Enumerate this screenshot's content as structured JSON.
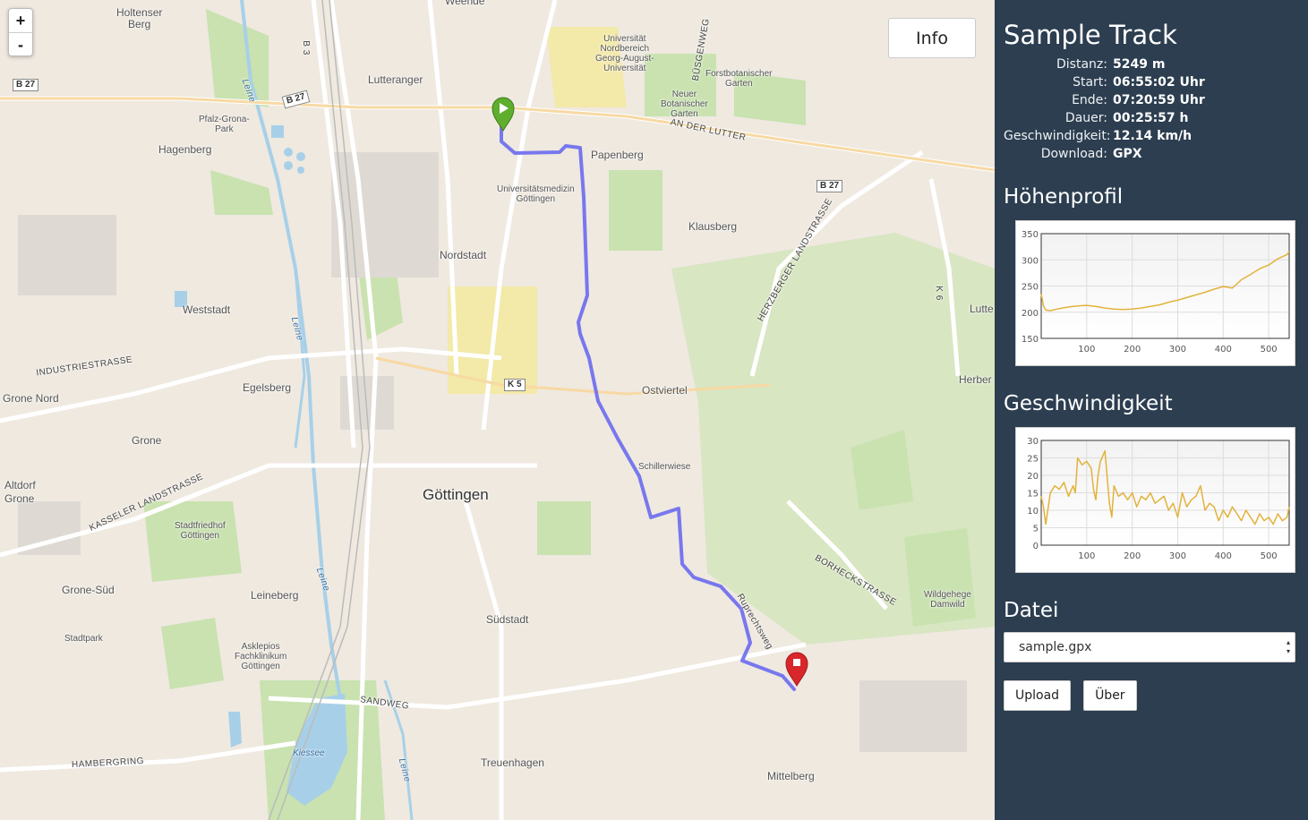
{
  "map": {
    "zoom_in": "+",
    "zoom_out": "-",
    "info_button": "Info",
    "places": [
      {
        "id": "weende",
        "text": "Weende"
      },
      {
        "id": "holtensen",
        "text": "Holtenser\nBerg"
      },
      {
        "id": "lutteranger",
        "text": "Lutteranger"
      },
      {
        "id": "pfalz",
        "text": "Pfalz-Grona-\nPark"
      },
      {
        "id": "hagenberg",
        "text": "Hagenberg"
      },
      {
        "id": "uni-nord",
        "text": "Universität\nNordbereich\nGeorg-August-\nUniversität"
      },
      {
        "id": "forstbot",
        "text": "Forstbotanischer\nGarten"
      },
      {
        "id": "neuer-bot",
        "text": "Neuer\nBotanischer\nGarten"
      },
      {
        "id": "papenberg",
        "text": "Papenberg"
      },
      {
        "id": "unimed",
        "text": "Universitätsmedizin\nGöttingen"
      },
      {
        "id": "klausberg",
        "text": "Klausberg"
      },
      {
        "id": "nordstadt",
        "text": "Nordstadt"
      },
      {
        "id": "weststadt",
        "text": "Weststadt"
      },
      {
        "id": "lutte",
        "text": "Lutte"
      },
      {
        "id": "egelsberg",
        "text": "Egelsberg"
      },
      {
        "id": "grone-nord",
        "text": "Grone Nord"
      },
      {
        "id": "herber",
        "text": "Herber"
      },
      {
        "id": "ostviertel",
        "text": "Ostviertel"
      },
      {
        "id": "grone",
        "text": "Grone"
      },
      {
        "id": "schillerwiese",
        "text": "Schillerwiese"
      },
      {
        "id": "altdorf",
        "text": "Altdorf\nGrone"
      },
      {
        "id": "goettingen",
        "text": "Göttingen"
      },
      {
        "id": "stadtfriedhof",
        "text": "Stadtfriedhof\nGöttingen"
      },
      {
        "id": "grone-sued",
        "text": "Grone-Süd"
      },
      {
        "id": "leineberg",
        "text": "Leineberg"
      },
      {
        "id": "wildgehege",
        "text": "Wildgehege\nDamwild"
      },
      {
        "id": "suedstadt",
        "text": "Südstadt"
      },
      {
        "id": "stadtpark",
        "text": "Stadtpark"
      },
      {
        "id": "asklepios",
        "text": "Asklepios\nFachklinikum\nGöttingen"
      },
      {
        "id": "kiessee",
        "text": "Kiessee"
      },
      {
        "id": "treuenhagen",
        "text": "Treuenhagen"
      },
      {
        "id": "mittelberg",
        "text": "Mittelberg"
      }
    ],
    "roads": [
      {
        "id": "b27-w",
        "text": "B 27"
      },
      {
        "id": "b27-n",
        "text": "B 27"
      },
      {
        "id": "b27-e",
        "text": "B 27"
      },
      {
        "id": "b3",
        "text": "B 3"
      },
      {
        "id": "k5",
        "text": "K 5"
      },
      {
        "id": "k6",
        "text": "K 6"
      },
      {
        "id": "an-der-lutter",
        "text": "AN DER LUTTER"
      },
      {
        "id": "buesgenweg",
        "text": "BÜSGENWEG"
      },
      {
        "id": "herzberger",
        "text": "HERZBERGER LANDSTRASSE"
      },
      {
        "id": "industrie",
        "text": "INDUSTRIESTRASSE"
      },
      {
        "id": "kasseler",
        "text": "KASSELER LANDSTRASSE"
      },
      {
        "id": "borheck",
        "text": "BORHECKSTRASSE"
      },
      {
        "id": "ruprecht",
        "text": "Ruprechtsweg"
      },
      {
        "id": "sandweg",
        "text": "SANDWEG"
      },
      {
        "id": "hambergring",
        "text": "HAMBERGRING"
      },
      {
        "id": "leine1",
        "text": "Leine"
      },
      {
        "id": "leine2",
        "text": "Leine"
      },
      {
        "id": "leine3",
        "text": "Leine"
      },
      {
        "id": "leine4",
        "text": "Leine"
      }
    ],
    "colors": {
      "track": "#6a6af0",
      "start_marker": "#5fae2e",
      "end_marker": "#d9262b",
      "water": "#a7d0e8",
      "park": "#c9e2b0"
    }
  },
  "sidebar": {
    "title": "Sample Track",
    "stats": [
      {
        "label": "Distanz:",
        "value": "5249 m"
      },
      {
        "label": "Start:",
        "value": "06:55:02 Uhr"
      },
      {
        "label": "Ende:",
        "value": "07:20:59 Uhr"
      },
      {
        "label": "Dauer:",
        "value": "00:25:57 h"
      },
      {
        "label": "Geschwindigkeit:",
        "value": "12.14 km/h"
      },
      {
        "label": "Download:",
        "value": "GPX"
      }
    ],
    "elevation_title": "Höhenprofil",
    "speed_title": "Geschwindigkeit",
    "file_title": "Datei",
    "file_selected": "sample.gpx",
    "upload_label": "Upload",
    "about_label": "Über"
  },
  "chart_data": [
    {
      "type": "line",
      "title": "Höhenprofil",
      "xlabel": "",
      "ylabel": "",
      "xlim": [
        0,
        545
      ],
      "ylim": [
        150,
        350
      ],
      "xticks": [
        100,
        200,
        300,
        400,
        500
      ],
      "yticks": [
        150,
        200,
        250,
        300,
        350
      ],
      "color": "#e3b23c",
      "series": [
        {
          "x": [
            0,
            5,
            10,
            20,
            40,
            60,
            80,
            100,
            120,
            140,
            160,
            180,
            200,
            220,
            240,
            260,
            280,
            300,
            320,
            340,
            360,
            380,
            400,
            420,
            440,
            460,
            480,
            500,
            520,
            540,
            545
          ],
          "y": [
            235,
            212,
            204,
            203,
            207,
            210,
            212,
            213,
            211,
            208,
            206,
            205,
            206,
            208,
            211,
            214,
            219,
            223,
            228,
            233,
            238,
            244,
            249,
            246,
            262,
            272,
            283,
            290,
            302,
            310,
            316
          ]
        }
      ]
    },
    {
      "type": "line",
      "title": "Geschwindigkeit",
      "xlabel": "",
      "ylabel": "",
      "xlim": [
        0,
        545
      ],
      "ylim": [
        0,
        30
      ],
      "xticks": [
        100,
        200,
        300,
        400,
        500
      ],
      "yticks": [
        0,
        5,
        10,
        15,
        20,
        25,
        30
      ],
      "color": "#e3b23c",
      "series": [
        {
          "x": [
            0,
            5,
            10,
            20,
            30,
            40,
            50,
            60,
            70,
            75,
            80,
            90,
            100,
            110,
            115,
            120,
            125,
            130,
            140,
            150,
            155,
            160,
            170,
            180,
            190,
            200,
            210,
            220,
            230,
            240,
            250,
            260,
            270,
            280,
            290,
            300,
            310,
            320,
            330,
            340,
            350,
            360,
            370,
            380,
            390,
            400,
            410,
            420,
            430,
            440,
            450,
            460,
            470,
            480,
            490,
            500,
            510,
            520,
            530,
            540,
            545
          ],
          "y": [
            14,
            11,
            6,
            15,
            17,
            16,
            18,
            14,
            17,
            15,
            25,
            23,
            24,
            22,
            16,
            13,
            20,
            24,
            27,
            12,
            8,
            17,
            14,
            15,
            13,
            15,
            11,
            14,
            13,
            15,
            12,
            13,
            14,
            10,
            12,
            8,
            15,
            11,
            13,
            14,
            17,
            10,
            12,
            11,
            7,
            10,
            8,
            11,
            9,
            7,
            10,
            8,
            6,
            9,
            7,
            8,
            6,
            9,
            7,
            8,
            11
          ]
        }
      ]
    }
  ]
}
